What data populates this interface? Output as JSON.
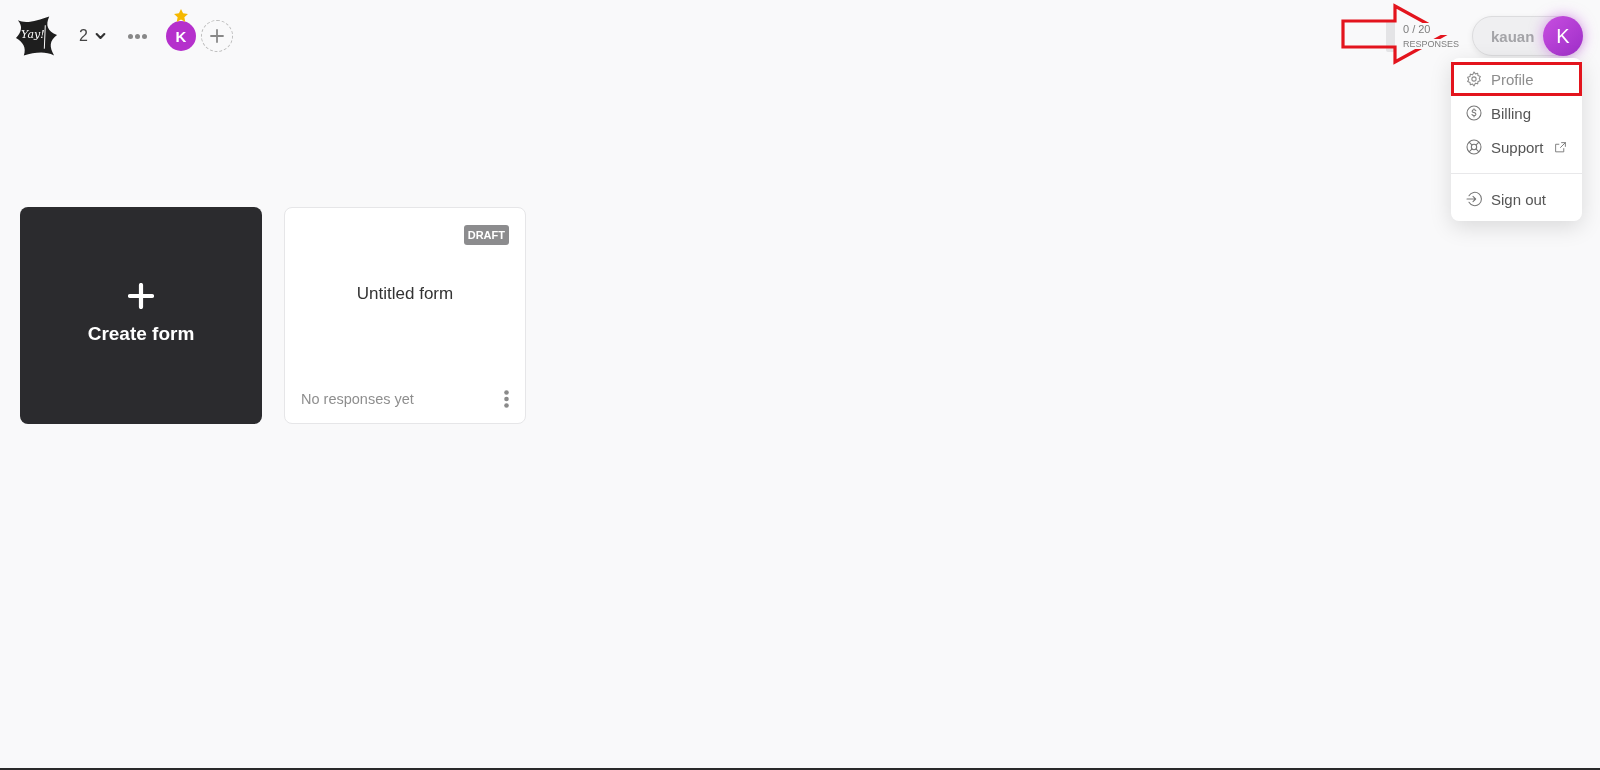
{
  "header": {
    "logo": {
      "text": "Yay!"
    },
    "workspace": {
      "label": "2"
    },
    "members": [
      {
        "initial": "K",
        "color": "#b530cc",
        "starred": true
      }
    ],
    "usage": {
      "reading": "0 / 20",
      "caption": "RESPONSES",
      "level": 0
    },
    "account": {
      "name": "kauan",
      "initial": "K"
    }
  },
  "account_menu": {
    "sections": [
      {
        "items": [
          {
            "kind": "profile",
            "label": "Profile",
            "highlighted": true,
            "external": false
          },
          {
            "kind": "billing",
            "label": "Billing",
            "highlighted": false,
            "external": false
          },
          {
            "kind": "support",
            "label": "Support",
            "highlighted": false,
            "external": true
          }
        ]
      },
      {
        "items": [
          {
            "kind": "signout",
            "label": "Sign out",
            "highlighted": false,
            "external": false
          }
        ]
      }
    ]
  },
  "forms": [
    {
      "kind": "create",
      "label": "Create form"
    },
    {
      "kind": "form",
      "title": "Untitled form",
      "status": "DRAFT",
      "footer": "No responses yet"
    }
  ]
}
